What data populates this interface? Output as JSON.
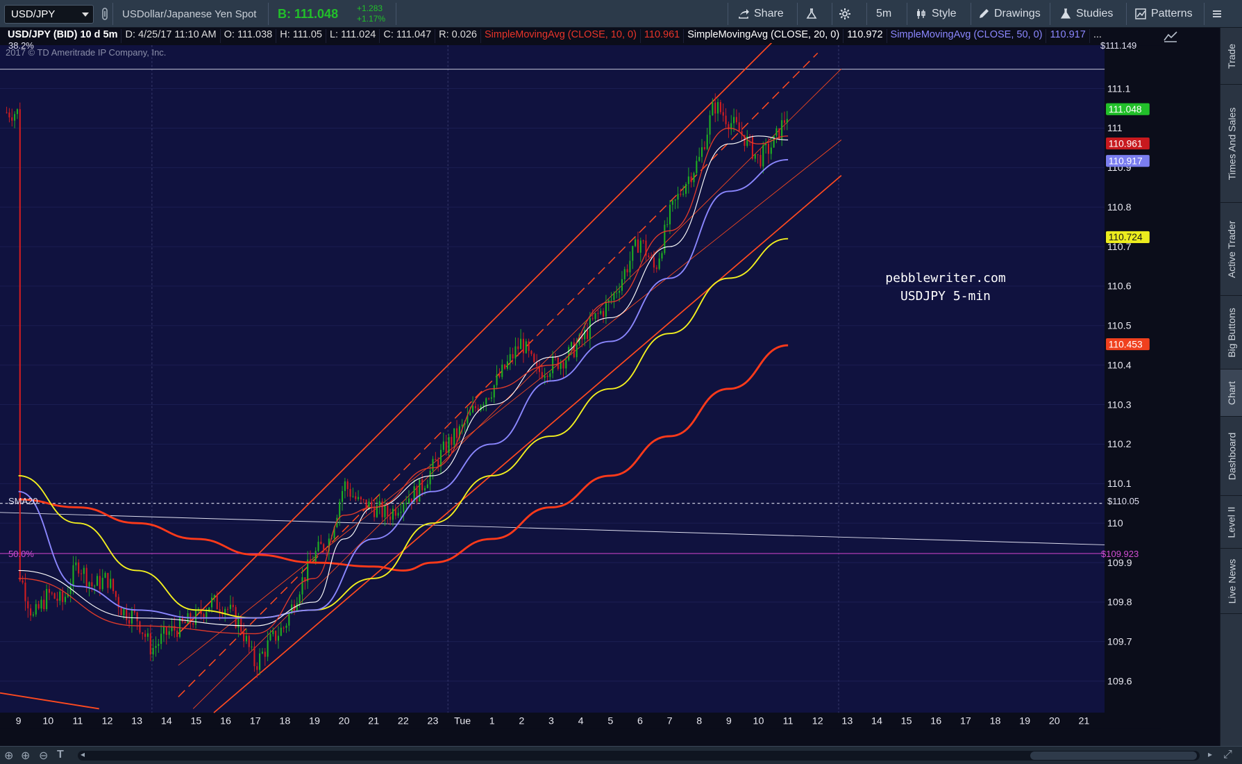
{
  "toolbar": {
    "symbol": "USD/JPY",
    "description": "USDollar/Japanese Yen Spot",
    "bid": "B: 111.048",
    "change_abs": "+1.283",
    "change_pct": "+1.17%",
    "share_label": "Share",
    "timeframe_label": "5m",
    "style_label": "Style",
    "drawings_label": "Drawings",
    "studies_label": "Studies",
    "patterns_label": "Patterns"
  },
  "header": {
    "title": "USD/JPY (BID) 10 d 5m",
    "date": "D: 4/25/17 11:10 AM",
    "open": "O: 111.038",
    "high": "H: 111.05",
    "low": "L: 111.024",
    "close": "C: 111.047",
    "range": "R: 0.026",
    "sma10_label": "SimpleMovingAvg (CLOSE, 10, 0)",
    "sma10_value": "110.961",
    "sma20_label": "SimpleMovingAvg (CLOSE, 20, 0)",
    "sma20_value": "110.972",
    "sma50_label": "SimpleMovingAvg (CLOSE, 50, 0)",
    "sma50_value": "110.917",
    "more": "..."
  },
  "chart": {
    "copyright": "2017 © TD Ameritrade IP Company, Inc.",
    "fib_38": "38.2%",
    "fib_38_value": "$111.149",
    "fib_50": "50.0%",
    "fib_50_value": "$109.923",
    "sma20_tag": "SMA20",
    "level_value": "$110.05",
    "watermark_line1": "pebblewriter.com",
    "watermark_line2": "USDJPY 5-min",
    "price_tags": [
      {
        "label": "111.048",
        "price": 111.048,
        "color": "#22c02a",
        "text": "#ffffff"
      },
      {
        "label": "110.961",
        "price": 110.961,
        "color": "#c8191e",
        "text": "#ffffff"
      },
      {
        "label": "110.917",
        "price": 110.917,
        "color": "#7b7ef0",
        "text": "#ffffff"
      },
      {
        "label": "110.724",
        "price": 110.724,
        "color": "#ecec1e",
        "text": "#1a1a1a"
      },
      {
        "label": "110.453",
        "price": 110.453,
        "color": "#f0401e",
        "text": "#ffffff"
      }
    ],
    "colors": {
      "background": "#10123f",
      "candle_up": "#1fb021",
      "candle_down": "#d31d20",
      "sma10": "#e23b2a",
      "sma20": "#ffffff",
      "sma50": "#8b87ff",
      "sma_yellow": "#f3f01f",
      "sma_orange": "#ff3a1a",
      "channel": "#ff4a1f",
      "fib": "#c040c0"
    }
  },
  "chart_data": {
    "type": "candlestick",
    "title": "USD/JPY (BID) 10 d 5m",
    "y_ticks": [
      111.1,
      111,
      110.9,
      110.8,
      110.7,
      110.6,
      110.5,
      110.4,
      110.3,
      110.2,
      110.1,
      110,
      109.9,
      109.8,
      109.7,
      109.6
    ],
    "ylim": [
      109.52,
      111.21
    ],
    "x_labels": [
      "9",
      "10",
      "11",
      "12",
      "13",
      "14",
      "15",
      "16",
      "17",
      "18",
      "19",
      "20",
      "21",
      "22",
      "23",
      "Tue",
      "1",
      "2",
      "3",
      "4",
      "5",
      "6",
      "7",
      "8",
      "9",
      "10",
      "11",
      "12",
      "13",
      "14",
      "15",
      "16",
      "17",
      "18",
      "19",
      "20",
      "21"
    ],
    "price_path": [
      [
        0,
        109.88
      ],
      [
        0.5,
        109.76
      ],
      [
        1,
        109.82
      ],
      [
        1.5,
        109.8
      ],
      [
        2,
        109.9
      ],
      [
        2.5,
        109.84
      ],
      [
        3,
        109.86
      ],
      [
        3.5,
        109.78
      ],
      [
        4,
        109.76
      ],
      [
        4.5,
        109.68
      ],
      [
        5,
        109.72
      ],
      [
        5.5,
        109.74
      ],
      [
        6,
        109.76
      ],
      [
        6.5,
        109.8
      ],
      [
        7,
        109.79
      ],
      [
        7.5,
        109.74
      ],
      [
        8,
        109.64
      ],
      [
        8.5,
        109.7
      ],
      [
        9,
        109.74
      ],
      [
        9.5,
        109.84
      ],
      [
        10,
        109.92
      ],
      [
        10.5,
        109.96
      ],
      [
        11,
        110.1
      ],
      [
        11.5,
        110.05
      ],
      [
        12,
        110.04
      ],
      [
        12.5,
        110.02
      ],
      [
        13,
        110.06
      ],
      [
        13.5,
        110.08
      ],
      [
        14,
        110.14
      ],
      [
        14.5,
        110.2
      ],
      [
        15,
        110.24
      ],
      [
        15.5,
        110.3
      ],
      [
        16,
        110.34
      ],
      [
        16.5,
        110.4
      ],
      [
        17,
        110.46
      ],
      [
        17.5,
        110.38
      ],
      [
        18,
        110.4
      ],
      [
        18.5,
        110.42
      ],
      [
        19,
        110.46
      ],
      [
        19.5,
        110.52
      ],
      [
        20,
        110.56
      ],
      [
        20.5,
        110.64
      ],
      [
        21,
        110.72
      ],
      [
        21.5,
        110.64
      ],
      [
        22,
        110.78
      ],
      [
        22.5,
        110.86
      ],
      [
        23,
        110.92
      ],
      [
        23.5,
        111.06
      ],
      [
        24,
        111.02
      ],
      [
        24.5,
        110.98
      ],
      [
        25,
        110.92
      ],
      [
        25.5,
        110.96
      ],
      [
        26,
        111.04
      ]
    ],
    "sma10": [
      [
        0,
        109.86
      ],
      [
        4,
        109.74
      ],
      [
        8,
        109.72
      ],
      [
        10,
        109.86
      ],
      [
        11,
        110.02
      ],
      [
        12,
        110.04
      ],
      [
        14,
        110.14
      ],
      [
        16,
        110.34
      ],
      [
        18,
        110.4
      ],
      [
        20,
        110.56
      ],
      [
        22,
        110.74
      ],
      [
        24,
        111.0
      ],
      [
        25,
        110.96
      ],
      [
        26,
        110.98
      ]
    ],
    "sma20": [
      [
        0,
        109.88
      ],
      [
        4,
        109.76
      ],
      [
        8,
        109.74
      ],
      [
        10,
        109.8
      ],
      [
        11,
        109.96
      ],
      [
        12,
        110.04
      ],
      [
        14,
        110.12
      ],
      [
        16,
        110.3
      ],
      [
        18,
        110.42
      ],
      [
        20,
        110.52
      ],
      [
        22,
        110.7
      ],
      [
        24,
        110.96
      ],
      [
        25,
        110.98
      ],
      [
        26,
        110.97
      ]
    ],
    "sma50": [
      [
        0,
        110.08
      ],
      [
        2,
        109.84
      ],
      [
        4,
        109.78
      ],
      [
        6,
        109.76
      ],
      [
        8,
        109.76
      ],
      [
        10,
        109.78
      ],
      [
        12,
        109.96
      ],
      [
        14,
        110.08
      ],
      [
        16,
        110.2
      ],
      [
        18,
        110.36
      ],
      [
        20,
        110.46
      ],
      [
        22,
        110.62
      ],
      [
        24,
        110.84
      ],
      [
        26,
        110.92
      ]
    ],
    "sma_yellow": [
      [
        0,
        110.12
      ],
      [
        2,
        110.0
      ],
      [
        4,
        109.88
      ],
      [
        6,
        109.78
      ],
      [
        8,
        109.76
      ],
      [
        10,
        109.78
      ],
      [
        12,
        109.86
      ],
      [
        14,
        110.0
      ],
      [
        16,
        110.12
      ],
      [
        18,
        110.22
      ],
      [
        20,
        110.34
      ],
      [
        22,
        110.48
      ],
      [
        24,
        110.62
      ],
      [
        26,
        110.72
      ]
    ],
    "sma_orange": [
      [
        0,
        110.06
      ],
      [
        2,
        110.04
      ],
      [
        4,
        110.0
      ],
      [
        6,
        109.96
      ],
      [
        8,
        109.92
      ],
      [
        10,
        109.9
      ],
      [
        12,
        109.89
      ],
      [
        13,
        109.88
      ],
      [
        14,
        109.9
      ],
      [
        16,
        109.96
      ],
      [
        18,
        110.04
      ],
      [
        20,
        110.12
      ],
      [
        22,
        110.22
      ],
      [
        24,
        110.34
      ],
      [
        26,
        110.45
      ]
    ]
  }
}
